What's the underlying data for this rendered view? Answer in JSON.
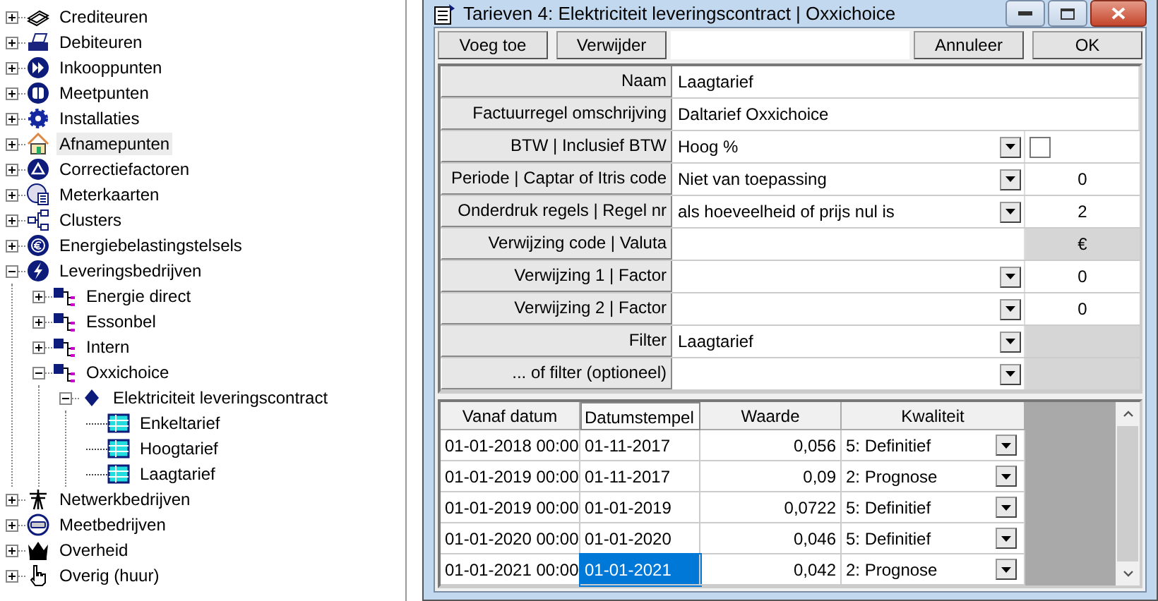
{
  "tree": [
    {
      "label": "Crediteuren",
      "expanded": false,
      "selected": false
    },
    {
      "label": "Debiteuren",
      "expanded": false,
      "selected": false
    },
    {
      "label": "Inkooppunten",
      "expanded": false,
      "selected": false
    },
    {
      "label": "Meetpunten",
      "expanded": false,
      "selected": false
    },
    {
      "label": "Installaties",
      "expanded": false,
      "selected": false
    },
    {
      "label": "Afnamepunten",
      "expanded": false,
      "selected": true
    },
    {
      "label": "Correctiefactoren",
      "expanded": false,
      "selected": false
    },
    {
      "label": "Meterkaarten",
      "expanded": false,
      "selected": false
    },
    {
      "label": "Clusters",
      "expanded": false,
      "selected": false
    },
    {
      "label": "Energiebelastingstelsels",
      "expanded": false,
      "selected": false
    },
    {
      "label": "Leveringsbedrijven",
      "expanded": true,
      "selected": false,
      "children": [
        {
          "label": "Energie direct",
          "expanded": false,
          "selected": false
        },
        {
          "label": "Essonbel",
          "expanded": false,
          "selected": false
        },
        {
          "label": "Intern",
          "expanded": false,
          "selected": false
        },
        {
          "label": "Oxxichoice",
          "expanded": true,
          "selected": false,
          "children": [
            {
              "label": "Elektriciteit leveringscontract",
              "expanded": true,
              "selected": false,
              "children": [
                {
                  "label": "Enkeltarief",
                  "selected": false
                },
                {
                  "label": "Hoogtarief",
                  "selected": false
                },
                {
                  "label": "Laagtarief",
                  "selected": false
                }
              ]
            }
          ]
        }
      ]
    },
    {
      "label": "Netwerkbedrijven",
      "expanded": false,
      "selected": false
    },
    {
      "label": "Meetbedrijven",
      "expanded": false,
      "selected": false
    },
    {
      "label": "Overheid",
      "expanded": false,
      "selected": false
    },
    {
      "label": "Overig (huur)",
      "expanded": false,
      "selected": false
    }
  ],
  "dialog": {
    "title": "Tarieven 4: Elektriciteit leveringscontract | Oxxichoice",
    "buttons_left": [
      "Voeg toe",
      "Verwijder"
    ],
    "buttons_right": [
      "Annuleer",
      "OK"
    ],
    "fields": [
      {
        "label": "Naam",
        "value": "Laagtarief",
        "dropdown": false
      },
      {
        "label": "Factuurregel omschrijving",
        "value": "Daltarief Oxxichoice",
        "dropdown": false
      },
      {
        "label": "BTW | Inclusief BTW",
        "value": "Hoog %",
        "dropdown": true,
        "side": {
          "kind": "checkbox",
          "checked": false
        }
      },
      {
        "label": "Periode | Captar of Itris code",
        "value": "Niet van toepassing",
        "dropdown": true,
        "side": {
          "kind": "text",
          "text": "0",
          "shaded": false
        }
      },
      {
        "label": "Onderdruk regels | Regel nr",
        "value": "als hoeveelheid of prijs nul is",
        "dropdown": true,
        "side": {
          "kind": "text",
          "text": "2",
          "shaded": false
        }
      },
      {
        "label": "Verwijzing code | Valuta",
        "dropdown": false,
        "side": {
          "kind": "text",
          "text": "€",
          "shaded": true
        }
      },
      {
        "label": "Verwijzing 1 | Factor",
        "dropdown": true,
        "side": {
          "kind": "text",
          "text": "0",
          "shaded": false
        }
      },
      {
        "label": "Verwijzing 2 | Factor",
        "dropdown": true,
        "side": {
          "kind": "text",
          "text": "0",
          "shaded": false
        }
      },
      {
        "label": "Filter",
        "value": "Laagtarief",
        "dropdown": true,
        "side": {
          "kind": "blank",
          "shaded": true
        }
      },
      {
        "label": "... of filter (optioneel)",
        "dropdown": true,
        "side": {
          "kind": "blank",
          "shaded": true
        }
      }
    ],
    "table": {
      "columns": [
        {
          "label": "Vanaf datum",
          "selected": false
        },
        {
          "label": "Datumstempel",
          "selected": true
        },
        {
          "label": "Waarde",
          "selected": false
        },
        {
          "label": "Kwaliteit",
          "selected": false
        }
      ],
      "rows": [
        {
          "vanaf_datum": "01-01-2018 00:00",
          "datumstempel": "01-11-2017",
          "waarde": "0,056",
          "kwaliteit": "5: Definitief",
          "selected": false
        },
        {
          "vanaf_datum": "01-01-2019 00:00",
          "datumstempel": "01-11-2017",
          "waarde": "0,09",
          "kwaliteit": "2: Prognose",
          "selected": false
        },
        {
          "vanaf_datum": "01-01-2019 00:00",
          "datumstempel": "01-01-2019",
          "waarde": "0,0722",
          "kwaliteit": "5: Definitief",
          "selected": false
        },
        {
          "vanaf_datum": "01-01-2020 00:00",
          "datumstempel": "01-01-2020",
          "waarde": "0,046",
          "kwaliteit": "5: Definitief",
          "selected": false
        },
        {
          "vanaf_datum": "01-01-2021 00:00",
          "datumstempel": "01-01-2021",
          "waarde": "0,042",
          "kwaliteit": "2: Prognose",
          "selected": true
        }
      ]
    }
  }
}
